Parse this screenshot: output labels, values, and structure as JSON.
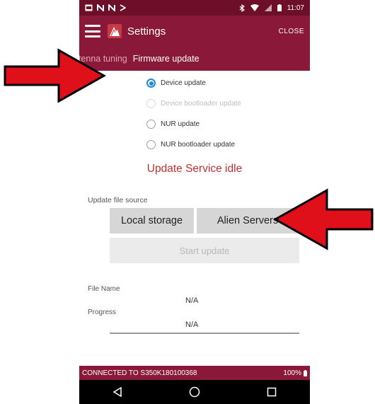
{
  "status_bar": {
    "time": "11:07"
  },
  "toolbar": {
    "title": "Settings",
    "close_label": "CLOSE"
  },
  "tabs": {
    "prev_label": "ntenna tuning",
    "active_label": "Firmware update"
  },
  "radios": [
    {
      "label": "Device update",
      "state": "checked"
    },
    {
      "label": "Device bootloader update",
      "state": "disabled"
    },
    {
      "label": "NUR update",
      "state": "unchecked"
    },
    {
      "label": "NUR bootloader update",
      "state": "unchecked"
    }
  ],
  "service_status": "Update Service idle",
  "source": {
    "label": "Update file source",
    "local_button": "Local storage",
    "alien_button": "Alien Servers",
    "start_button": "Start update"
  },
  "file_info": {
    "name_label": "File Name",
    "name_value": "N/A",
    "progress_label": "Progress",
    "progress_value": "N/A"
  },
  "connection": {
    "text": "CONNECTED TO S350K180100368",
    "battery": "100%"
  },
  "colors": {
    "primary": "#8a1838",
    "status_bar": "#6e0f29",
    "accent_red": "#c0322f",
    "radio_blue": "#1f88d6",
    "annotation_arrow": "#e0101a"
  }
}
